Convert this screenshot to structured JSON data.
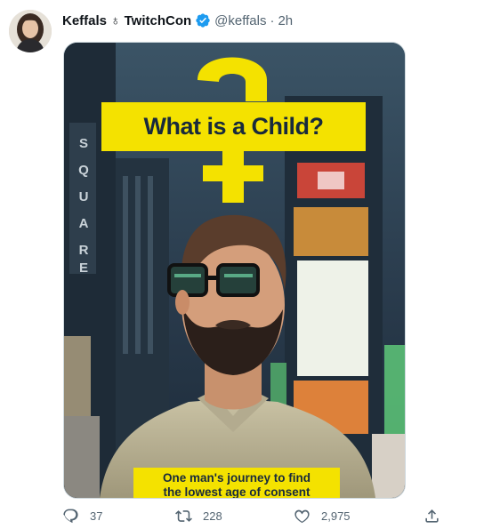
{
  "tweet": {
    "display_name": "Keffals ♁ TwitchCon",
    "handle": "@keffals",
    "separator": "·",
    "time": "2h",
    "verified_icon": "verified-badge-icon",
    "accent_color": "#1d9bf0"
  },
  "media": {
    "poster_title": "What is a Child?",
    "caption_line1": "One man's journey to find",
    "caption_line2": "the lowest age of consent",
    "poster_yellow": "#f4e200",
    "building_text": "SQUARE"
  },
  "actions": {
    "reply_count": "37",
    "retweet_count": "228",
    "like_count": "2,975",
    "reply_icon": "reply-icon",
    "retweet_icon": "retweet-icon",
    "like_icon": "heart-icon",
    "share_icon": "share-icon"
  }
}
